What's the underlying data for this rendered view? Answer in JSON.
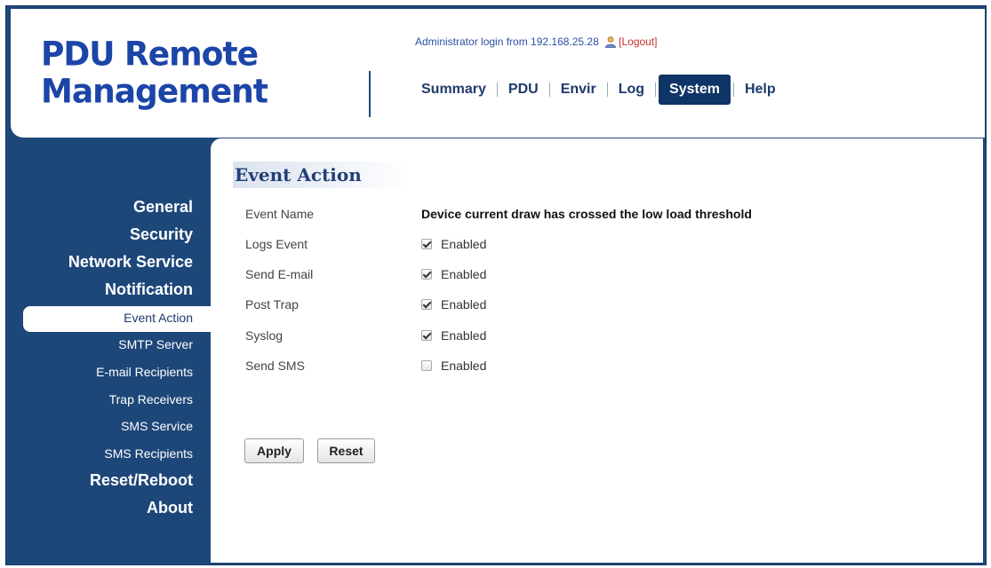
{
  "header": {
    "logo_line1": "PDU Remote",
    "logo_line2": "Management",
    "admin_text": "Administrator login from 192.168.25.28",
    "logout_label": "[Logout]",
    "user_icon": "user-icon"
  },
  "nav": {
    "tabs": [
      {
        "label": "Summary"
      },
      {
        "label": "PDU"
      },
      {
        "label": "Envir"
      },
      {
        "label": "Log"
      },
      {
        "label": "System"
      },
      {
        "label": "Help"
      }
    ],
    "active": "System"
  },
  "sidebar": {
    "items": [
      {
        "label": "General",
        "level": "main"
      },
      {
        "label": "Security",
        "level": "main"
      },
      {
        "label": "Network Service",
        "level": "main"
      },
      {
        "label": "Notification",
        "level": "main"
      },
      {
        "label": "Event Action",
        "level": "sub",
        "active": true
      },
      {
        "label": "SMTP Server",
        "level": "sub"
      },
      {
        "label": "E-mail Recipients",
        "level": "sub"
      },
      {
        "label": "Trap Receivers",
        "level": "sub"
      },
      {
        "label": "SMS Service",
        "level": "sub"
      },
      {
        "label": "SMS Recipients",
        "level": "sub"
      },
      {
        "label": "Reset/Reboot",
        "level": "main"
      },
      {
        "label": "About",
        "level": "main"
      }
    ]
  },
  "main": {
    "title": "Event Action",
    "event_name_label": "Event Name",
    "event_name_value": "Device current draw has crossed the low load threshold",
    "options": [
      {
        "label": "Logs Event",
        "checkbox_label": "Enabled",
        "checked": true
      },
      {
        "label": "Send E-mail",
        "checkbox_label": "Enabled",
        "checked": true
      },
      {
        "label": "Post Trap",
        "checkbox_label": "Enabled",
        "checked": true
      },
      {
        "label": "Syslog",
        "checkbox_label": "Enabled",
        "checked": true
      },
      {
        "label": "Send SMS",
        "checkbox_label": "Enabled",
        "checked": false
      }
    ],
    "apply_label": "Apply",
    "reset_label": "Reset"
  },
  "colors": {
    "frame": "#1e4779",
    "logo": "#1c45a8",
    "active_tab": "#0f3466",
    "logout": "#c3322a"
  }
}
